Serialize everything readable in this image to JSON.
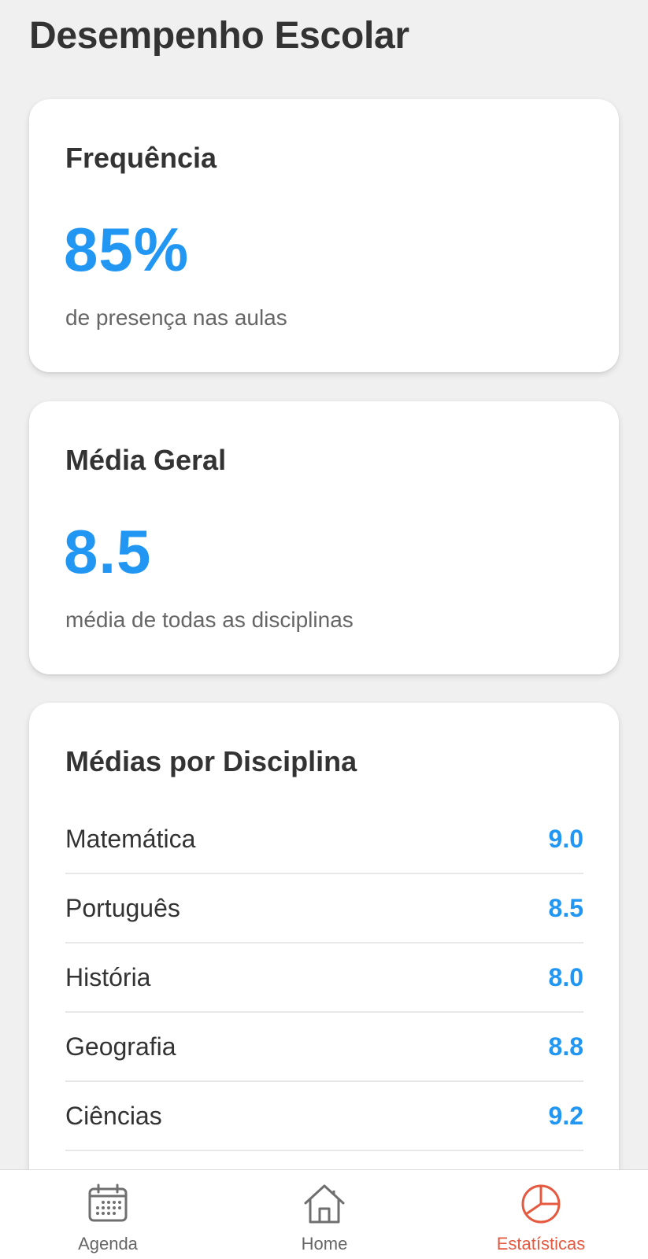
{
  "header": {
    "title": "Desempenho Escolar"
  },
  "frequencia": {
    "title": "Frequência",
    "value": "85%",
    "caption": "de presença nas aulas"
  },
  "media_geral": {
    "title": "Média Geral",
    "value": "8.5",
    "caption": "média de todas as disciplinas"
  },
  "disciplinas": {
    "title": "Médias por Disciplina",
    "items": [
      {
        "name": "Matemática",
        "grade": "9.0"
      },
      {
        "name": "Português",
        "grade": "8.5"
      },
      {
        "name": "História",
        "grade": "8.0"
      },
      {
        "name": "Geografia",
        "grade": "8.8"
      },
      {
        "name": "Ciências",
        "grade": "9.2"
      }
    ]
  },
  "bottom_nav": {
    "items": [
      {
        "label": "Agenda",
        "icon": "calendar-icon",
        "active": false
      },
      {
        "label": "Home",
        "icon": "home-icon",
        "active": false
      },
      {
        "label": "Estatísticas",
        "icon": "pie-chart-icon",
        "active": true
      }
    ]
  },
  "colors": {
    "accent": "#2196f3",
    "active_tab": "#e4593f",
    "background": "#f0f0f0"
  }
}
